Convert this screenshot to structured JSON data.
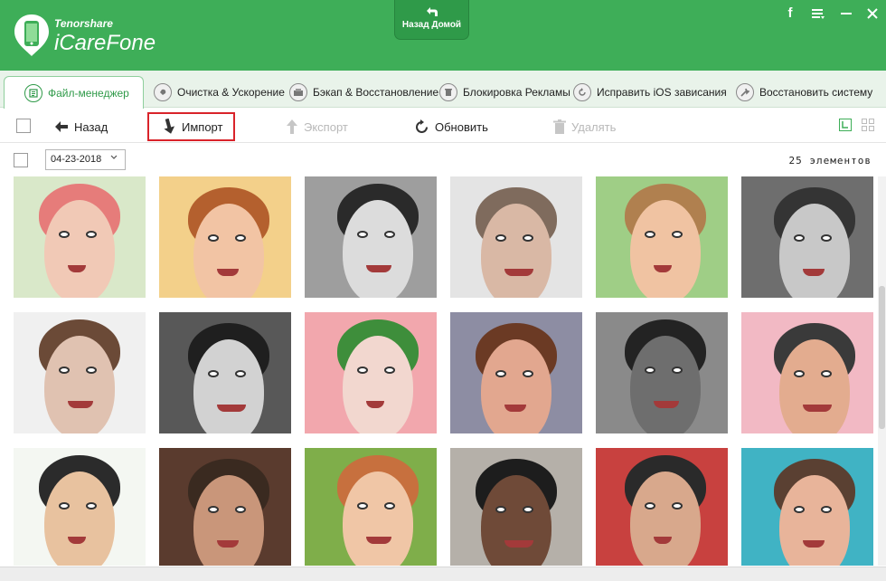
{
  "app": {
    "brand_small": "Tenorshare",
    "brand_big": "iCareFone",
    "home_button": "Назад Домой",
    "window_controls": [
      "facebook-icon",
      "menu-icon",
      "minimize-icon",
      "close-icon"
    ],
    "accent": "#3eae58"
  },
  "tabs": [
    {
      "label": "Файл-менеджер",
      "icon": "file-manager-icon",
      "active": true
    },
    {
      "label": "Очистка & Ускорение",
      "icon": "rocket-icon"
    },
    {
      "label": "Бэкап & Восстановление",
      "icon": "backup-icon"
    },
    {
      "label": "Блокировка Рекламы",
      "icon": "trash-icon"
    },
    {
      "label": "Исправить iOS зависания",
      "icon": "refresh-icon"
    },
    {
      "label": "Восстановить систему",
      "icon": "wrench-icon"
    }
  ],
  "toolbar": {
    "back": "Назад",
    "import": "Импорт",
    "export": "Экспорт",
    "refresh": "Обновить",
    "delete": "Удалять"
  },
  "filter": {
    "date": "04-23-2018",
    "count": "25 элементов"
  },
  "photos": [
    {
      "id": "photo-1",
      "bg": "#d9e8c9",
      "skin": "#f1c9b6",
      "hair": "#e67c7a"
    },
    {
      "id": "photo-2",
      "bg": "#f3d08a",
      "skin": "#f2c4a4",
      "hair": "#b4602e"
    },
    {
      "id": "photo-3",
      "bg": "#9e9e9e",
      "skin": "#dcdcdc",
      "hair": "#2a2a2a"
    },
    {
      "id": "photo-4",
      "bg": "#e4e4e4",
      "skin": "#d9b8a5",
      "hair": "#7f6b5d"
    },
    {
      "id": "photo-5",
      "bg": "#9fce86",
      "skin": "#f0c3a2",
      "hair": "#b0804f"
    },
    {
      "id": "photo-6",
      "bg": "#6e6e6e",
      "skin": "#c8c8c8",
      "hair": "#343434"
    },
    {
      "id": "photo-7",
      "bg": "#f0f0f0",
      "skin": "#e0c2b1",
      "hair": "#6b4a37"
    },
    {
      "id": "photo-8",
      "bg": "#585858",
      "skin": "#d2d2d2",
      "hair": "#1f1f1f"
    },
    {
      "id": "photo-9",
      "bg": "#f2a7ad",
      "skin": "#f2d7cf",
      "hair": "#3e8e3b"
    },
    {
      "id": "photo-10",
      "bg": "#8d8da3",
      "skin": "#e2a78f",
      "hair": "#6b3a24"
    },
    {
      "id": "photo-11",
      "bg": "#8a8a8a",
      "skin": "#6e6e6e",
      "hair": "#232323"
    },
    {
      "id": "photo-12",
      "bg": "#f2b9c4",
      "skin": "#e3ac8f",
      "hair": "#3a3a3a"
    },
    {
      "id": "photo-13",
      "bg": "#f4f7f2",
      "skin": "#e8c29f",
      "hair": "#2b2b2b"
    },
    {
      "id": "photo-14",
      "bg": "#5a3b2e",
      "skin": "#c9967a",
      "hair": "#3a2a20"
    },
    {
      "id": "photo-15",
      "bg": "#7fae4a",
      "skin": "#f0c6a6",
      "hair": "#c7703e"
    },
    {
      "id": "photo-16",
      "bg": "#b5b0a9",
      "skin": "#6f4a38",
      "hair": "#1d1d1d"
    },
    {
      "id": "photo-17",
      "bg": "#c8413f",
      "skin": "#d8a88c",
      "hair": "#2a2a2a"
    },
    {
      "id": "photo-18",
      "bg": "#40b3c4",
      "skin": "#e8b49a",
      "hair": "#5a4032"
    }
  ]
}
